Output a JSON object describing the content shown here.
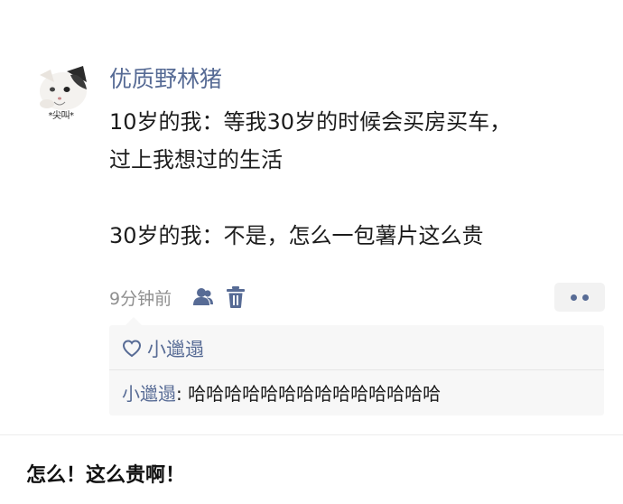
{
  "post": {
    "avatar": {
      "icon": "cat-meme-avatar",
      "caption": "*尖叫*"
    },
    "username": "优质野林猪",
    "content": {
      "line1": "10岁的我：等我30岁的时候会买房买车，",
      "line2": "过上我想过的生活",
      "line3": "30岁的我：不是，怎么一包薯片这么贵"
    },
    "time": "9分钟前",
    "icons": {
      "visibility": "people-icon",
      "delete": "trash-icon",
      "more": "more-dots-icon",
      "like": "heart-icon"
    },
    "likes": {
      "names": "小邋遢"
    },
    "comments": [
      {
        "author": "小邋遢",
        "separator": ": ",
        "text": "哈哈哈哈哈哈哈哈哈哈哈哈哈哈"
      }
    ]
  },
  "caption": "怎么！这么贵啊！",
  "colors": {
    "link_blue": "#576b95",
    "meta_gray": "#8f8f8f",
    "comment_bg": "#f7f7f7"
  }
}
